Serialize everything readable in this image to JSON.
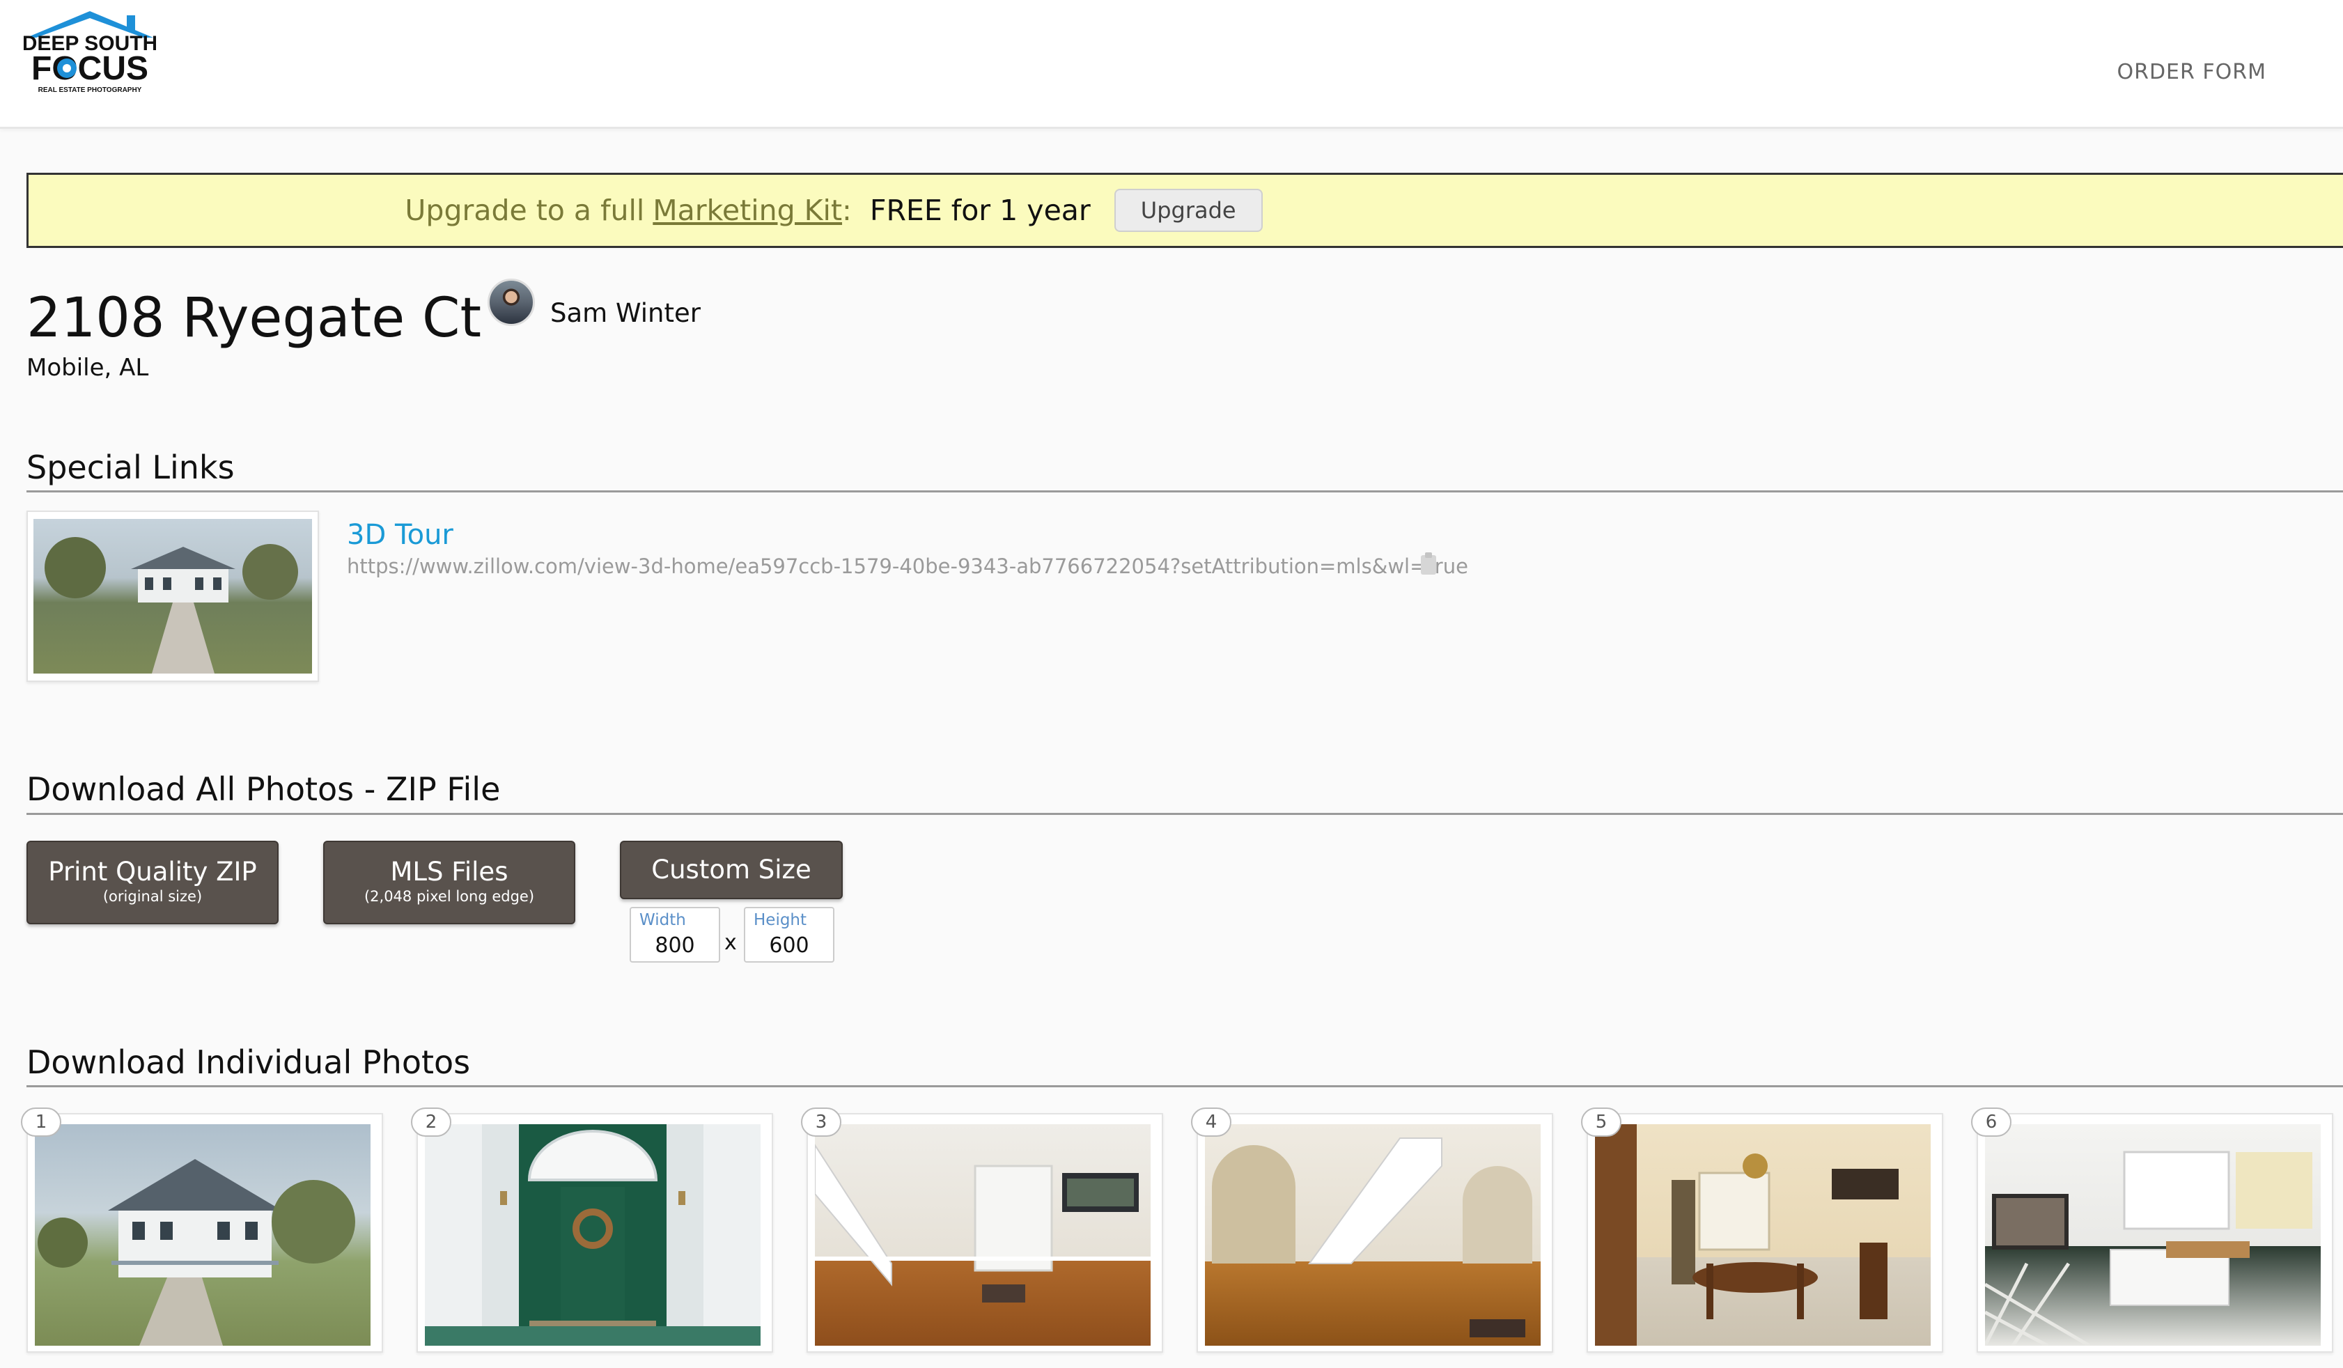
{
  "header": {
    "logo_line1": "DEEP SOUTH",
    "logo_line2": "FOCUS",
    "logo_tagline": "REAL ESTATE PHOTOGRAPHY",
    "nav_order_form": "ORDER FORM"
  },
  "banner": {
    "text_prefix": "Upgrade to a full",
    "link_text": "Marketing Kit",
    "colon": ":",
    "free_text": "FREE for 1 year",
    "button_label": "Upgrade"
  },
  "property": {
    "address": "2108 Ryegate Ct",
    "city": "Mobile, AL",
    "agent_name": "Sam Winter"
  },
  "special_links": {
    "title": "Special Links",
    "items": [
      {
        "label": "3D Tour",
        "url": "https://www.zillow.com/view-3d-home/ea597ccb-1579-40be-9343-ab7766722054?setAttribution=mls&wl=true"
      }
    ]
  },
  "download_zip": {
    "title": "Download All Photos - ZIP File",
    "buttons": [
      {
        "label": "Print Quality ZIP",
        "sub": "(original size)"
      },
      {
        "label": "MLS Files",
        "sub": "(2,048 pixel long edge)"
      },
      {
        "label": "Custom Size",
        "sub": ""
      }
    ],
    "width_label": "Width",
    "width_value": "800",
    "separator": "x",
    "height_label": "Height",
    "height_value": "600"
  },
  "individual": {
    "title": "Download Individual Photos",
    "photos": [
      {
        "number": "1"
      },
      {
        "number": "2"
      },
      {
        "number": "3"
      },
      {
        "number": "4"
      },
      {
        "number": "5"
      },
      {
        "number": "6"
      }
    ]
  },
  "colors": {
    "banner_bg": "#fbfbbe",
    "link_blue": "#1a9ad6",
    "dark_button": "#59524d"
  }
}
